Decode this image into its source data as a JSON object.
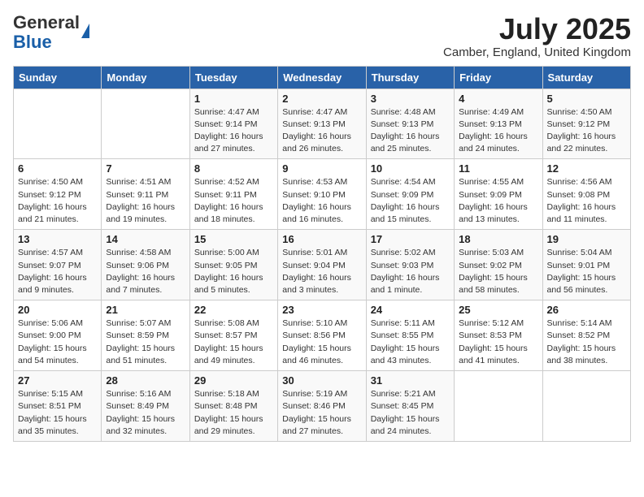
{
  "logo": {
    "general": "General",
    "blue": "Blue"
  },
  "title": "July 2025",
  "location": "Camber, England, United Kingdom",
  "days_of_week": [
    "Sunday",
    "Monday",
    "Tuesday",
    "Wednesday",
    "Thursday",
    "Friday",
    "Saturday"
  ],
  "weeks": [
    [
      {
        "day": "",
        "info": ""
      },
      {
        "day": "",
        "info": ""
      },
      {
        "day": "1",
        "info": "Sunrise: 4:47 AM\nSunset: 9:14 PM\nDaylight: 16 hours\nand 27 minutes."
      },
      {
        "day": "2",
        "info": "Sunrise: 4:47 AM\nSunset: 9:13 PM\nDaylight: 16 hours\nand 26 minutes."
      },
      {
        "day": "3",
        "info": "Sunrise: 4:48 AM\nSunset: 9:13 PM\nDaylight: 16 hours\nand 25 minutes."
      },
      {
        "day": "4",
        "info": "Sunrise: 4:49 AM\nSunset: 9:13 PM\nDaylight: 16 hours\nand 24 minutes."
      },
      {
        "day": "5",
        "info": "Sunrise: 4:50 AM\nSunset: 9:12 PM\nDaylight: 16 hours\nand 22 minutes."
      }
    ],
    [
      {
        "day": "6",
        "info": "Sunrise: 4:50 AM\nSunset: 9:12 PM\nDaylight: 16 hours\nand 21 minutes."
      },
      {
        "day": "7",
        "info": "Sunrise: 4:51 AM\nSunset: 9:11 PM\nDaylight: 16 hours\nand 19 minutes."
      },
      {
        "day": "8",
        "info": "Sunrise: 4:52 AM\nSunset: 9:11 PM\nDaylight: 16 hours\nand 18 minutes."
      },
      {
        "day": "9",
        "info": "Sunrise: 4:53 AM\nSunset: 9:10 PM\nDaylight: 16 hours\nand 16 minutes."
      },
      {
        "day": "10",
        "info": "Sunrise: 4:54 AM\nSunset: 9:09 PM\nDaylight: 16 hours\nand 15 minutes."
      },
      {
        "day": "11",
        "info": "Sunrise: 4:55 AM\nSunset: 9:09 PM\nDaylight: 16 hours\nand 13 minutes."
      },
      {
        "day": "12",
        "info": "Sunrise: 4:56 AM\nSunset: 9:08 PM\nDaylight: 16 hours\nand 11 minutes."
      }
    ],
    [
      {
        "day": "13",
        "info": "Sunrise: 4:57 AM\nSunset: 9:07 PM\nDaylight: 16 hours\nand 9 minutes."
      },
      {
        "day": "14",
        "info": "Sunrise: 4:58 AM\nSunset: 9:06 PM\nDaylight: 16 hours\nand 7 minutes."
      },
      {
        "day": "15",
        "info": "Sunrise: 5:00 AM\nSunset: 9:05 PM\nDaylight: 16 hours\nand 5 minutes."
      },
      {
        "day": "16",
        "info": "Sunrise: 5:01 AM\nSunset: 9:04 PM\nDaylight: 16 hours\nand 3 minutes."
      },
      {
        "day": "17",
        "info": "Sunrise: 5:02 AM\nSunset: 9:03 PM\nDaylight: 16 hours\nand 1 minute."
      },
      {
        "day": "18",
        "info": "Sunrise: 5:03 AM\nSunset: 9:02 PM\nDaylight: 15 hours\nand 58 minutes."
      },
      {
        "day": "19",
        "info": "Sunrise: 5:04 AM\nSunset: 9:01 PM\nDaylight: 15 hours\nand 56 minutes."
      }
    ],
    [
      {
        "day": "20",
        "info": "Sunrise: 5:06 AM\nSunset: 9:00 PM\nDaylight: 15 hours\nand 54 minutes."
      },
      {
        "day": "21",
        "info": "Sunrise: 5:07 AM\nSunset: 8:59 PM\nDaylight: 15 hours\nand 51 minutes."
      },
      {
        "day": "22",
        "info": "Sunrise: 5:08 AM\nSunset: 8:57 PM\nDaylight: 15 hours\nand 49 minutes."
      },
      {
        "day": "23",
        "info": "Sunrise: 5:10 AM\nSunset: 8:56 PM\nDaylight: 15 hours\nand 46 minutes."
      },
      {
        "day": "24",
        "info": "Sunrise: 5:11 AM\nSunset: 8:55 PM\nDaylight: 15 hours\nand 43 minutes."
      },
      {
        "day": "25",
        "info": "Sunrise: 5:12 AM\nSunset: 8:53 PM\nDaylight: 15 hours\nand 41 minutes."
      },
      {
        "day": "26",
        "info": "Sunrise: 5:14 AM\nSunset: 8:52 PM\nDaylight: 15 hours\nand 38 minutes."
      }
    ],
    [
      {
        "day": "27",
        "info": "Sunrise: 5:15 AM\nSunset: 8:51 PM\nDaylight: 15 hours\nand 35 minutes."
      },
      {
        "day": "28",
        "info": "Sunrise: 5:16 AM\nSunset: 8:49 PM\nDaylight: 15 hours\nand 32 minutes."
      },
      {
        "day": "29",
        "info": "Sunrise: 5:18 AM\nSunset: 8:48 PM\nDaylight: 15 hours\nand 29 minutes."
      },
      {
        "day": "30",
        "info": "Sunrise: 5:19 AM\nSunset: 8:46 PM\nDaylight: 15 hours\nand 27 minutes."
      },
      {
        "day": "31",
        "info": "Sunrise: 5:21 AM\nSunset: 8:45 PM\nDaylight: 15 hours\nand 24 minutes."
      },
      {
        "day": "",
        "info": ""
      },
      {
        "day": "",
        "info": ""
      }
    ]
  ]
}
